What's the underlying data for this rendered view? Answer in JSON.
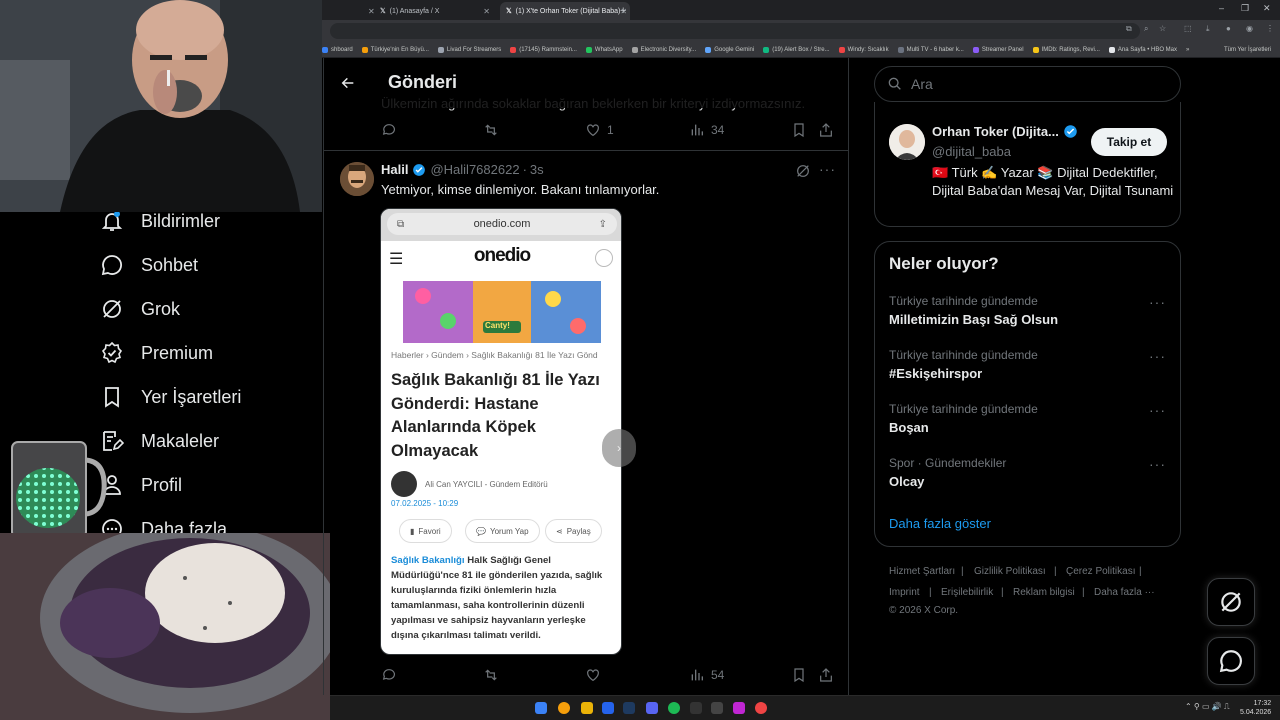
{
  "browser": {
    "tabs": [
      {
        "title": "(1) Anasayfa / X",
        "active": false
      },
      {
        "title": "(1) X'te Orhan Toker (Dijital Baba)",
        "active": true
      }
    ],
    "new_tab": "+",
    "window_controls": [
      "–",
      "❐",
      "✕"
    ],
    "bookmarks": [
      {
        "label": "shboard",
        "color": "#3b82f6"
      },
      {
        "label": "Türkiye'nin En Büyü...",
        "color": "#f59e0b"
      },
      {
        "label": "Livad For Streamers",
        "color": "#9ca3af"
      },
      {
        "label": "(17145) Rammstein...",
        "color": "#ef4444"
      },
      {
        "label": "WhatsApp",
        "color": "#22c55e"
      },
      {
        "label": "Electronic Diversity...",
        "color": "#a3a3a3"
      },
      {
        "label": "Google Gemini",
        "color": "#60a5fa"
      },
      {
        "label": "(19) Alert Box / Stre...",
        "color": "#10b981"
      },
      {
        "label": "Windy: Sıcaklık",
        "color": "#ef4444"
      },
      {
        "label": "Multi TV - 6 haber k...",
        "color": "#6b7280"
      },
      {
        "label": "Streamer Panel",
        "color": "#8b5cf6"
      },
      {
        "label": "IMDb: Ratings, Revi...",
        "color": "#f5c518"
      },
      {
        "label": "Ana Sayfa • HBO Max",
        "color": "#e5e7eb"
      }
    ],
    "bookmarks_more": "»",
    "all_bookmarks": "Tüm Yer İşaretleri"
  },
  "sidebar": {
    "items": [
      {
        "label": "Bildirimler",
        "icon": "bell-icon"
      },
      {
        "label": "Sohbet",
        "icon": "chat-icon"
      },
      {
        "label": "Grok",
        "icon": "grok-icon"
      },
      {
        "label": "Premium",
        "icon": "premium-icon"
      },
      {
        "label": "Yer İşaretleri",
        "icon": "bookmark-icon"
      },
      {
        "label": "Makaleler",
        "icon": "article-icon"
      },
      {
        "label": "Profil",
        "icon": "person-icon"
      },
      {
        "label": "Daha fazla",
        "icon": "more-icon"
      }
    ]
  },
  "header": {
    "title": "Gönderi",
    "back_icon": "arrow-left-icon"
  },
  "post1": {
    "partial_text": "Ülkemizin ağırında sokaklar bağıran beklerken bir kriteryi izdiyormazsınız.",
    "actions": {
      "reply": "",
      "repost": "",
      "like": "1",
      "views": "34"
    }
  },
  "post2": {
    "name": "Halil",
    "handle": "@Halil7682622",
    "time": "3s",
    "text": "Yetmiyor, kimse dinlemiyor. Bakanı tınlamıyorlar.",
    "actions": {
      "reply": "",
      "repost": "",
      "like": "",
      "views": "54"
    }
  },
  "article": {
    "url": "onedio.com",
    "logo": "onedio",
    "breadcrumb": "Haberler › Gündem › Sağlık Bakanlığı 81 İle Yazı Gönd",
    "title": "Sağlık Bakanlığı 81 İle Yazı Gönderdi: Hastane Alanlarında Köpek Olmayacak",
    "author": "Ali Can YAYCILI",
    "author_role": "- Gündem Editörü",
    "date": "07.02.2025 - 10:29",
    "buttons": [
      "Favori",
      "Yorum Yap",
      "Paylaş"
    ],
    "body_link": "Sağlık Bakanlığı",
    "body": " Halk Sağlığı Genel Müdürlüğü'nce 81 ile gönderilen yazıda, sağlık kuruluşlarında fiziki önlemlerin hızla tamamlanması, saha kontrollerinin düzenli yapılması ve sahipsiz hayvanların yerleşke dışına çıkarılması talimatı verildi.",
    "game_text": "Canty!"
  },
  "search": {
    "placeholder": "Ara"
  },
  "profile_card": {
    "name": "Orhan Toker (Dijita...",
    "handle": "@dijital_baba",
    "follow_label": "Takip et",
    "bio": "🇹🇷 Türk ✍️ Yazar 📚 Dijital Dedektifler, Dijital Baba'dan Mesaj Var, Dijital Tsunami"
  },
  "trends": {
    "title": "Neler oluyor?",
    "items": [
      {
        "meta": "Türkiye tarihinde gündemde",
        "name": "Milletimizin Başı Sağ Olsun"
      },
      {
        "meta": "Türkiye tarihinde gündemde",
        "name": "#Eskişehirspor"
      },
      {
        "meta": "Türkiye tarihinde gündemde",
        "name": "Boşan"
      },
      {
        "meta": "Spor · Gündemdekiler",
        "name": "Olcay"
      }
    ],
    "show_more": "Daha fazla göster"
  },
  "footer": {
    "links": [
      "Hizmet Şartları",
      "Gizlilik Politikası",
      "Çerez Politikası",
      "Imprint",
      "Erişilebilirlik",
      "Reklam bilgisi",
      "Daha fazla ···"
    ],
    "copyright": "© 2026 X Corp."
  },
  "taskbar": {
    "time": "17:32",
    "date": "5.04.2026"
  },
  "colors": {
    "accent": "#1d9bf0",
    "link": "#1d9bf0",
    "background": "#000000"
  }
}
